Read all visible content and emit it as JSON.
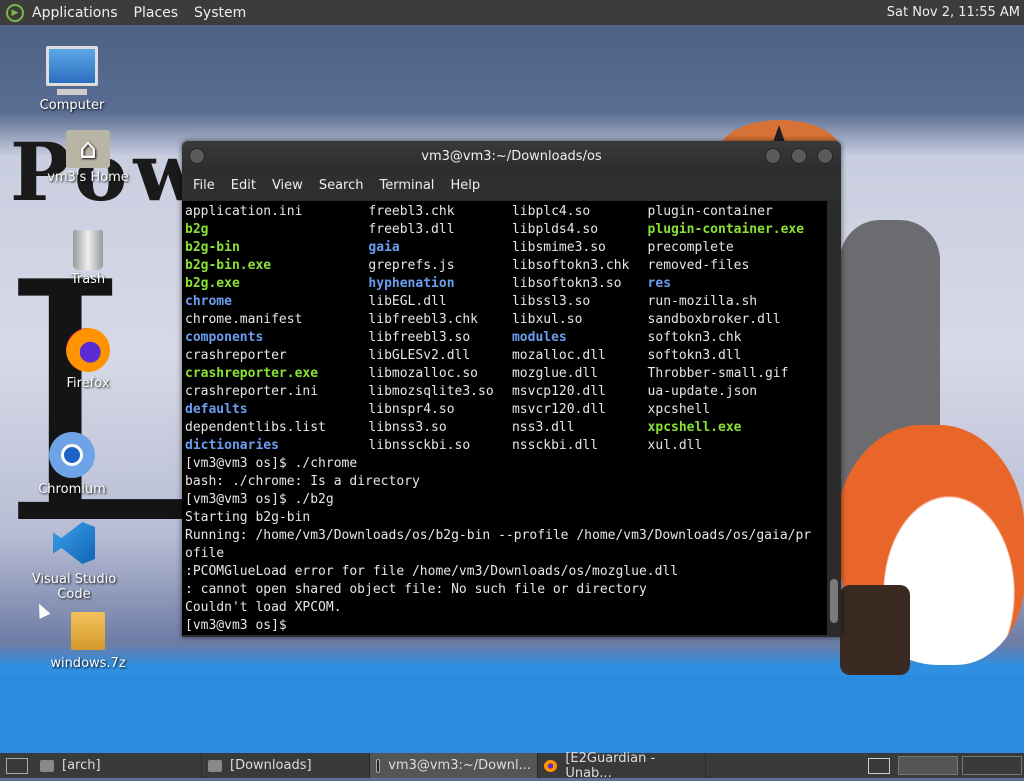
{
  "top_panel": {
    "menus": [
      "Applications",
      "Places",
      "System"
    ],
    "clock": "Sat Nov  2, 11:55 AM"
  },
  "desktop": {
    "wallpaper_text": "Pow",
    "icons": [
      {
        "label": "Computer",
        "icon": "computer-icon"
      },
      {
        "label": "vm3's Home",
        "icon": "home-folder-icon"
      },
      {
        "label": "Trash",
        "icon": "trash-icon"
      },
      {
        "label": "Firefox",
        "icon": "firefox-icon"
      },
      {
        "label": "Chromium",
        "icon": "chromium-icon"
      },
      {
        "label": "Visual Studio Code",
        "icon": "vscode-icon"
      },
      {
        "label": "windows.7z",
        "icon": "archive-icon"
      }
    ]
  },
  "terminal": {
    "title": "vm3@vm3:~/Downloads/os",
    "menu": [
      "File",
      "Edit",
      "View",
      "Search",
      "Terminal",
      "Help"
    ],
    "listing": [
      [
        [
          "application.ini",
          "norm"
        ],
        [
          "freebl3.chk",
          "norm"
        ],
        [
          "libplc4.so",
          "norm"
        ],
        [
          "plugin-container",
          "norm"
        ]
      ],
      [
        [
          "b2g",
          "exe"
        ],
        [
          "freebl3.dll",
          "norm"
        ],
        [
          "libplds4.so",
          "norm"
        ],
        [
          "plugin-container.exe",
          "exe"
        ]
      ],
      [
        [
          "b2g-bin",
          "exe"
        ],
        [
          "gaia",
          "dir"
        ],
        [
          "libsmime3.so",
          "norm"
        ],
        [
          "precomplete",
          "norm"
        ]
      ],
      [
        [
          "b2g-bin.exe",
          "exe"
        ],
        [
          "greprefs.js",
          "norm"
        ],
        [
          "libsoftokn3.chk",
          "norm"
        ],
        [
          "removed-files",
          "norm"
        ]
      ],
      [
        [
          "b2g.exe",
          "exe"
        ],
        [
          "hyphenation",
          "dir"
        ],
        [
          "libsoftokn3.so",
          "norm"
        ],
        [
          "res",
          "dir"
        ]
      ],
      [
        [
          "chrome",
          "dir"
        ],
        [
          "libEGL.dll",
          "norm"
        ],
        [
          "libssl3.so",
          "norm"
        ],
        [
          "run-mozilla.sh",
          "norm"
        ]
      ],
      [
        [
          "chrome.manifest",
          "norm"
        ],
        [
          "libfreebl3.chk",
          "norm"
        ],
        [
          "libxul.so",
          "norm"
        ],
        [
          "sandboxbroker.dll",
          "norm"
        ]
      ],
      [
        [
          "components",
          "dir"
        ],
        [
          "libfreebl3.so",
          "norm"
        ],
        [
          "modules",
          "dir"
        ],
        [
          "softokn3.chk",
          "norm"
        ]
      ],
      [
        [
          "crashreporter",
          "norm"
        ],
        [
          "libGLESv2.dll",
          "norm"
        ],
        [
          "mozalloc.dll",
          "norm"
        ],
        [
          "softokn3.dll",
          "norm"
        ]
      ],
      [
        [
          "crashreporter.exe",
          "exe"
        ],
        [
          "libmozalloc.so",
          "norm"
        ],
        [
          "mozglue.dll",
          "norm"
        ],
        [
          "Throbber-small.gif",
          "norm"
        ]
      ],
      [
        [
          "crashreporter.ini",
          "norm"
        ],
        [
          "libmozsqlite3.so",
          "norm"
        ],
        [
          "msvcp120.dll",
          "norm"
        ],
        [
          "ua-update.json",
          "norm"
        ]
      ],
      [
        [
          "defaults",
          "dir"
        ],
        [
          "libnspr4.so",
          "norm"
        ],
        [
          "msvcr120.dll",
          "norm"
        ],
        [
          "xpcshell",
          "norm"
        ]
      ],
      [
        [
          "dependentlibs.list",
          "norm"
        ],
        [
          "libnss3.so",
          "norm"
        ],
        [
          "nss3.dll",
          "norm"
        ],
        [
          "xpcshell.exe",
          "exe"
        ]
      ],
      [
        [
          "dictionaries",
          "dir"
        ],
        [
          "libnssckbi.so",
          "norm"
        ],
        [
          "nssckbi.dll",
          "norm"
        ],
        [
          "xul.dll",
          "norm"
        ]
      ]
    ],
    "output": [
      "[vm3@vm3 os]$ ./chrome",
      "bash: ./chrome: Is a directory",
      "[vm3@vm3 os]$ ./b2g",
      "Starting b2g-bin",
      "Running: /home/vm3/Downloads/os/b2g-bin --profile /home/vm3/Downloads/os/gaia/pr",
      "ofile",
      ":PCOMGlueLoad error for file /home/vm3/Downloads/os/mozglue.dll",
      ": cannot open shared object file: No such file or directory",
      "Couldn't load XPCOM.",
      "[vm3@vm3 os]$ "
    ]
  },
  "taskbar": {
    "tasks": [
      {
        "label": "[arch]",
        "icon": "folder-icon"
      },
      {
        "label": "[Downloads]",
        "icon": "folder-icon"
      },
      {
        "label": "vm3@vm3:~/Downl...",
        "icon": "terminal-icon"
      },
      {
        "label": "[E2Guardian - Unab...",
        "icon": "firefox-icon"
      }
    ]
  }
}
